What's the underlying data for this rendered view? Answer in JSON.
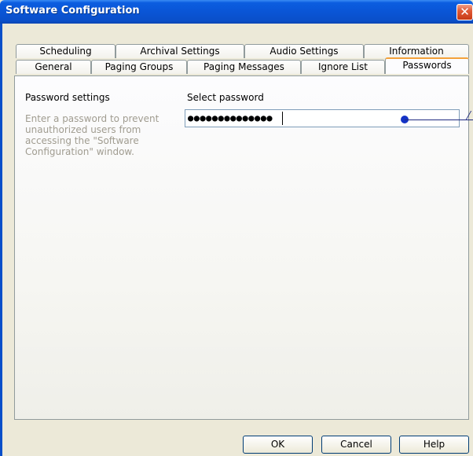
{
  "window": {
    "title": "Software Configuration",
    "close_label": "✕"
  },
  "tabs": {
    "row_back": [
      "Scheduling",
      "Archival Settings",
      "Audio Settings",
      "Information"
    ],
    "row_front": [
      "General",
      "Paging Groups",
      "Paging Messages",
      "Ignore List",
      "Passwords"
    ],
    "selected": "Passwords"
  },
  "passwords": {
    "section_label": "Password settings",
    "description": "Enter a password to prevent\nunauthorized users from\naccessing the \"Software\nConfiguration\" window.",
    "field_label": "Select password",
    "field_value": "●●●●●●●●●●●●●●"
  },
  "buttons": {
    "ok": "OK",
    "cancel": "Cancel",
    "help": "Help"
  },
  "colors": {
    "title_bar": "#0a55d6",
    "selected_tab_accent": "#f4a13b",
    "marker": "#1433c6"
  }
}
